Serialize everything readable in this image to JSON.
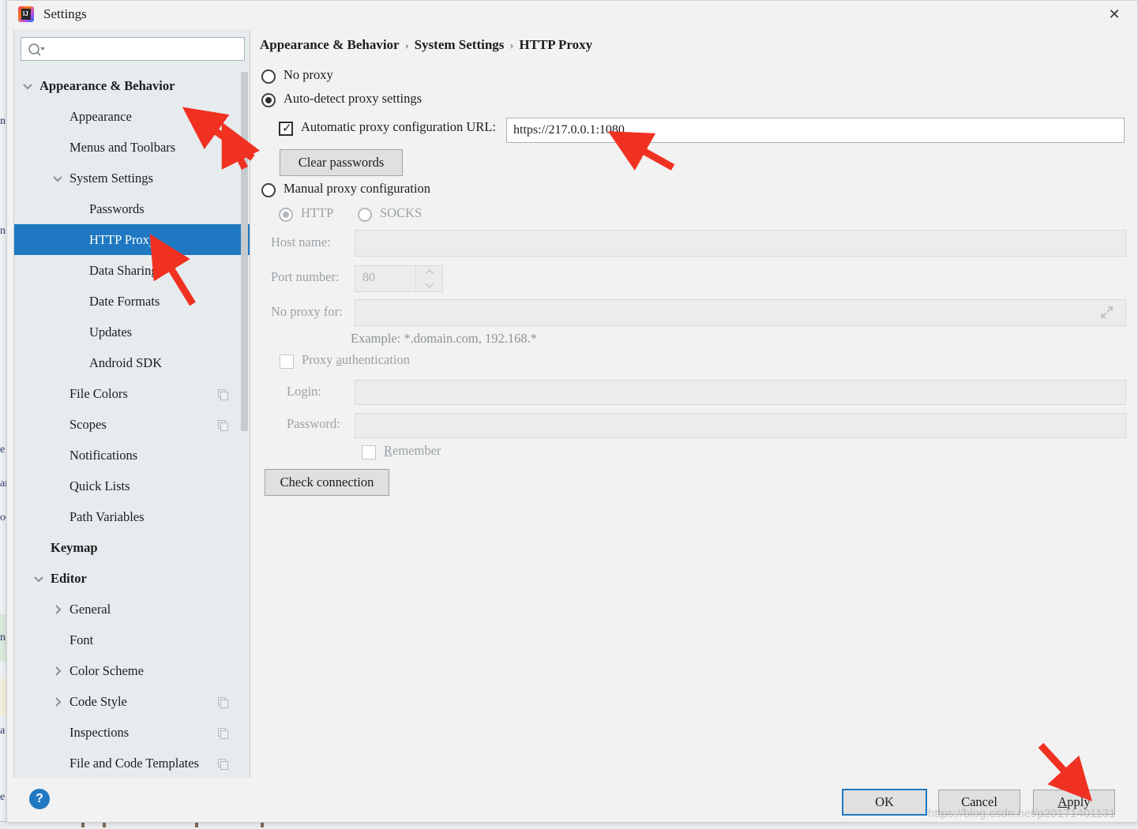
{
  "window": {
    "title": "Settings",
    "app_icon": "intellij-idea-icon",
    "close_label": "✕"
  },
  "sidebar": {
    "search": {
      "placeholder": "",
      "value": "",
      "icon": "search-icon"
    },
    "items": [
      {
        "label": "Appearance & Behavior",
        "indent": 32,
        "bold": true,
        "twisty": "down",
        "selected": false,
        "dup": false
      },
      {
        "label": "Appearance",
        "indent": 70,
        "bold": false,
        "twisty": "none",
        "selected": false,
        "dup": false
      },
      {
        "label": "Menus and Toolbars",
        "indent": 70,
        "bold": false,
        "twisty": "none",
        "selected": false,
        "dup": false
      },
      {
        "label": "System Settings",
        "indent": 70,
        "bold": false,
        "twisty": "down",
        "selected": false,
        "dup": false
      },
      {
        "label": "Passwords",
        "indent": 95,
        "bold": false,
        "twisty": "none",
        "selected": false,
        "dup": false
      },
      {
        "label": "HTTP Proxy",
        "indent": 95,
        "bold": false,
        "twisty": "none",
        "selected": true,
        "dup": false
      },
      {
        "label": "Data Sharing",
        "indent": 95,
        "bold": false,
        "twisty": "none",
        "selected": false,
        "dup": false
      },
      {
        "label": "Date Formats",
        "indent": 95,
        "bold": false,
        "twisty": "none",
        "selected": false,
        "dup": false
      },
      {
        "label": "Updates",
        "indent": 95,
        "bold": false,
        "twisty": "none",
        "selected": false,
        "dup": false
      },
      {
        "label": "Android SDK",
        "indent": 95,
        "bold": false,
        "twisty": "none",
        "selected": false,
        "dup": false
      },
      {
        "label": "File Colors",
        "indent": 70,
        "bold": false,
        "twisty": "none",
        "selected": false,
        "dup": true
      },
      {
        "label": "Scopes",
        "indent": 70,
        "bold": false,
        "twisty": "none",
        "selected": false,
        "dup": true
      },
      {
        "label": "Notifications",
        "indent": 70,
        "bold": false,
        "twisty": "none",
        "selected": false,
        "dup": false
      },
      {
        "label": "Quick Lists",
        "indent": 70,
        "bold": false,
        "twisty": "none",
        "selected": false,
        "dup": false
      },
      {
        "label": "Path Variables",
        "indent": 70,
        "bold": false,
        "twisty": "none",
        "selected": false,
        "dup": false
      },
      {
        "label": "Keymap",
        "indent": 46,
        "bold": true,
        "twisty": "none",
        "selected": false,
        "dup": false
      },
      {
        "label": "Editor",
        "indent": 46,
        "bold": true,
        "twisty": "down",
        "selected": false,
        "dup": false
      },
      {
        "label": "General",
        "indent": 70,
        "bold": false,
        "twisty": "right",
        "selected": false,
        "dup": false
      },
      {
        "label": "Font",
        "indent": 70,
        "bold": false,
        "twisty": "none",
        "selected": false,
        "dup": false
      },
      {
        "label": "Color Scheme",
        "indent": 70,
        "bold": false,
        "twisty": "right",
        "selected": false,
        "dup": false
      },
      {
        "label": "Code Style",
        "indent": 70,
        "bold": false,
        "twisty": "right",
        "selected": false,
        "dup": true
      },
      {
        "label": "Inspections",
        "indent": 70,
        "bold": false,
        "twisty": "none",
        "selected": false,
        "dup": true
      },
      {
        "label": "File and Code Templates",
        "indent": 70,
        "bold": false,
        "twisty": "none",
        "selected": false,
        "dup": true
      }
    ]
  },
  "breadcrumb": {
    "part1": "Appearance & Behavior",
    "sep": "›",
    "part2": "System Settings",
    "part3": "HTTP Proxy"
  },
  "proxy": {
    "no_proxy_label": "No proxy",
    "auto_detect_label": "Auto-detect proxy settings",
    "auto_config_url_label": "Automatic proxy configuration URL:",
    "auto_config_url_value": "https://217.0.0.1:1080",
    "clear_passwords_label": "Clear passwords",
    "manual_label": "Manual proxy configuration",
    "http_label": "HTTP",
    "socks_label": "SOCKS",
    "host_name_label": "Host name:",
    "host_name_value": "",
    "port_number_label": "Port number:",
    "port_number_value": "80",
    "no_proxy_for_label": "No proxy for:",
    "no_proxy_for_value": "",
    "no_proxy_for_expand_icon": "expand-icon",
    "example_text": "Example: *.domain.com, 192.168.*",
    "proxy_auth_label": "Proxy authentication",
    "proxy_auth_label_pre": "Proxy ",
    "proxy_auth_label_key": "a",
    "proxy_auth_label_post": "uthentication",
    "login_label": "Login:",
    "login_value": "",
    "password_label": "Password:",
    "password_value": "",
    "remember_label_key": "R",
    "remember_label_post": "emember",
    "check_connection_label": "Check connection",
    "selected_mode": "auto-detect",
    "auto_config_checked": true,
    "proxy_type": "HTTP"
  },
  "footer": {
    "help_icon": "?",
    "ok_label": "OK",
    "cancel_label": "Cancel",
    "apply_label_key": "A",
    "apply_label_post": "pply"
  },
  "annotations": {
    "arrow_color": "#f03122",
    "arrow_count": 4,
    "watermark": "https://blog.csdn.net/p20171401131"
  },
  "colors": {
    "accent": "#1f78c1",
    "selection": "#1f78c1",
    "sidebar_bg": "#e6ebee",
    "dialog_bg": "#f2f2f2",
    "arrow_red": "#f03122"
  },
  "background_editor": {
    "fragments": [
      "n",
      "e",
      "ar",
      "oc",
      "n",
      "a",
      "e"
    ]
  }
}
